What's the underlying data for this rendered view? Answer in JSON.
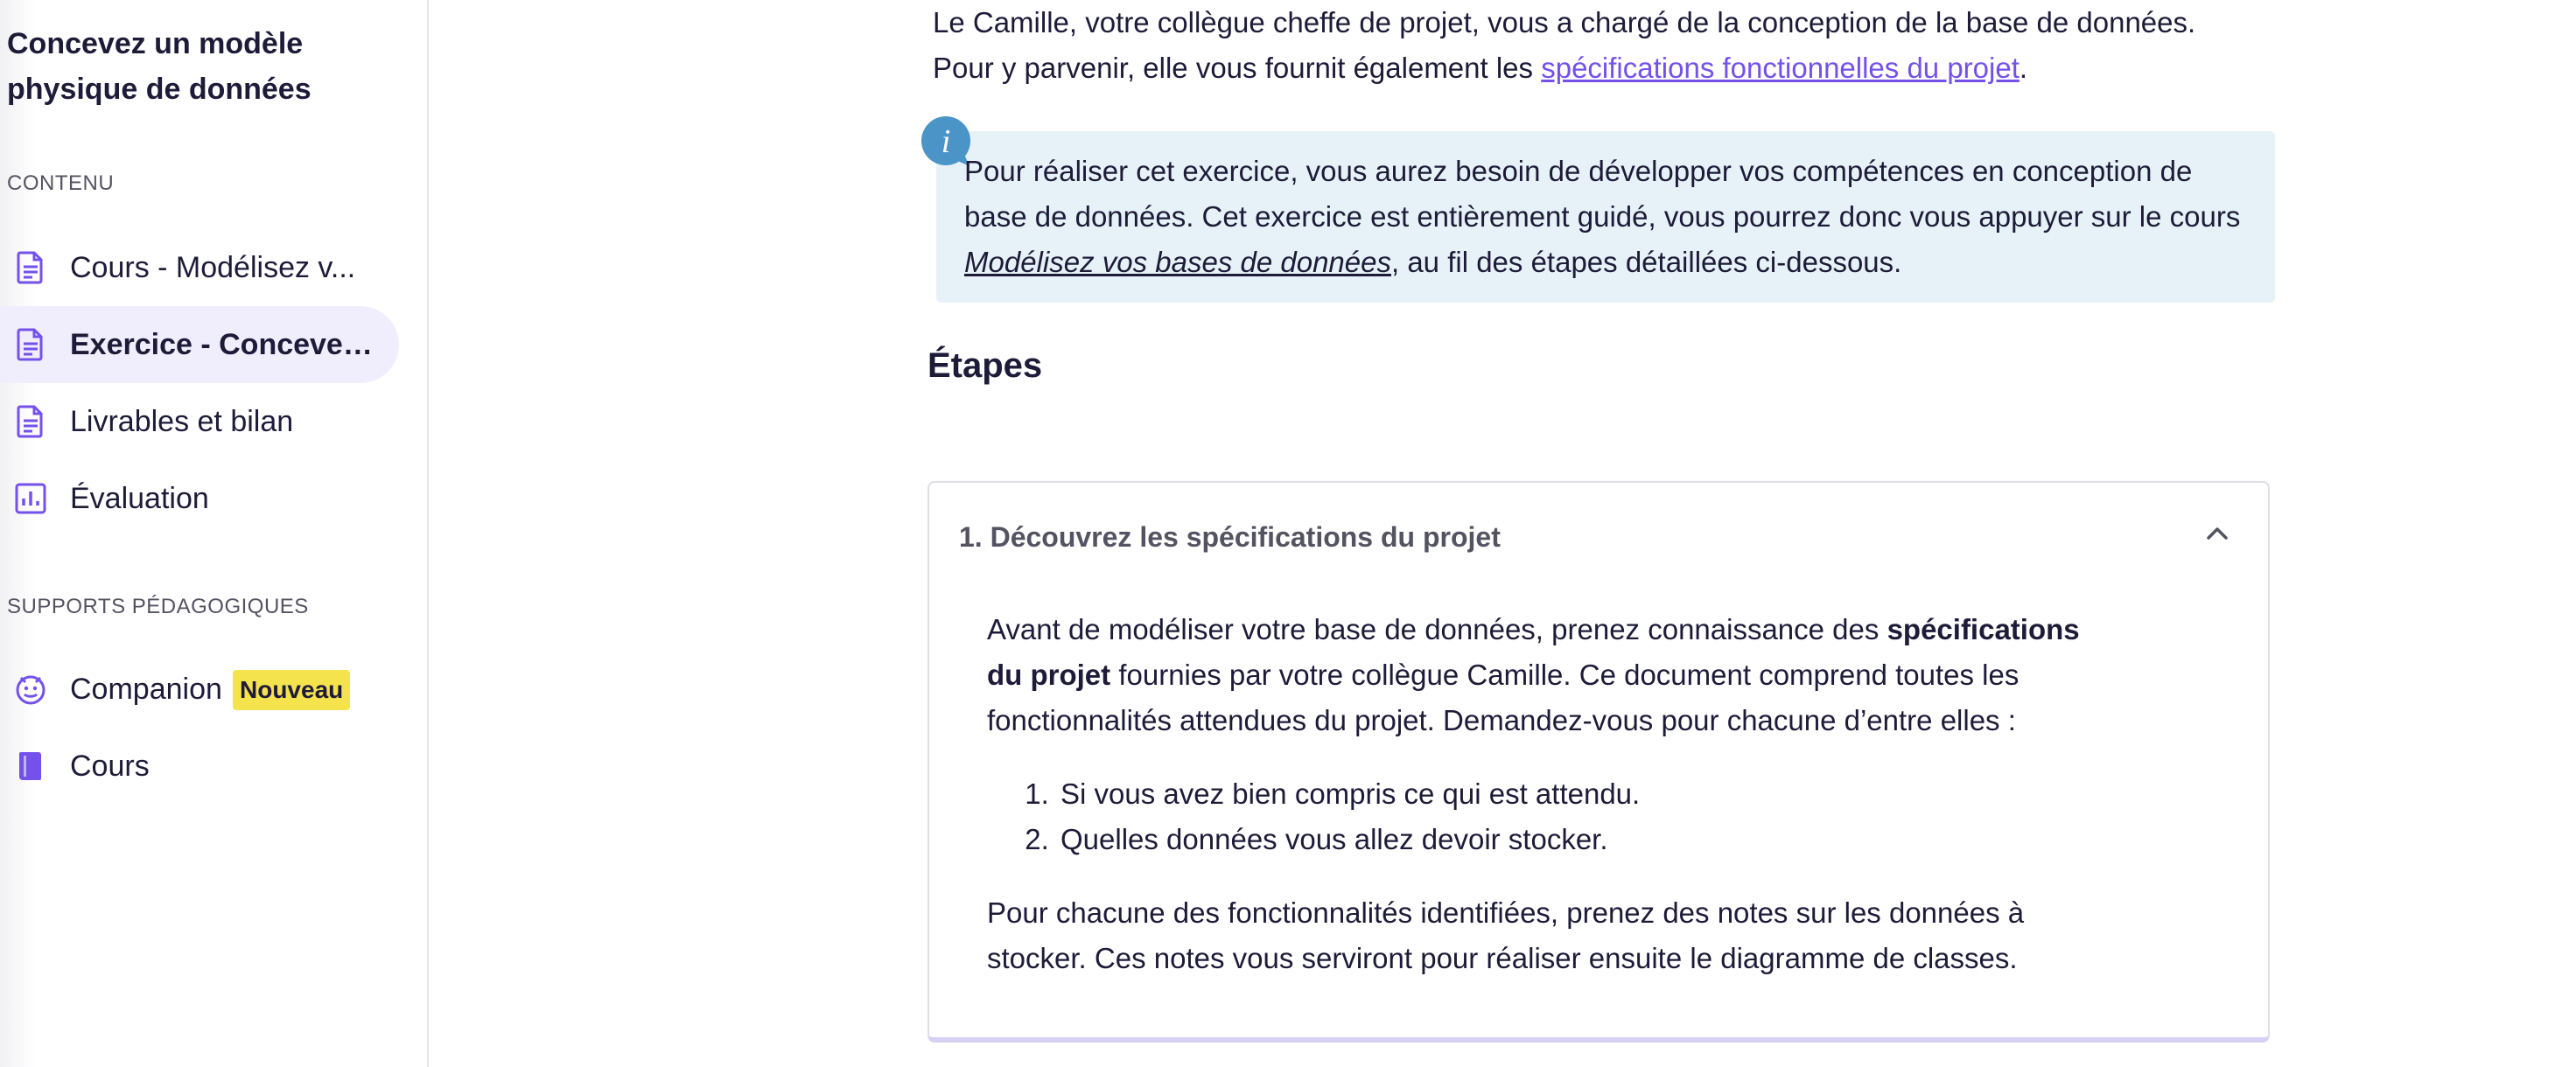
{
  "sidebar": {
    "course_title": "Concevez un modèle physique de données",
    "content_label": "CONTENU",
    "items": [
      {
        "label": "Cours - Modélisez v...",
        "icon": "document-icon"
      },
      {
        "label": "Exercice - Concevez...",
        "icon": "document-icon"
      },
      {
        "label": "Livrables et bilan",
        "icon": "document-icon"
      },
      {
        "label": "Évaluation",
        "icon": "chart-icon"
      }
    ],
    "supports_label": "SUPPORTS PÉDAGOGIQUES",
    "supports": [
      {
        "label": "Companion",
        "badge": "Nouveau",
        "icon": "companion-icon"
      },
      {
        "label": "Cours",
        "icon": "book-icon"
      }
    ]
  },
  "intro": {
    "line1": "Le Camille, votre collègue cheffe de projet, vous a chargé de la conception de la base de données.",
    "line2_before": "Pour y parvenir, elle vous fournit également les ",
    "line2_link": "spécifications fonctionnelles du projet",
    "line2_after": "."
  },
  "info": {
    "before": "Pour réaliser cet exercice, vous aurez besoin de développer vos compétences en conception de base de données. Cet exercice est entièrement guidé, vous pourrez donc vous appuyer sur le cours ",
    "course_link": "Modélisez vos bases de données",
    "after": ", au fil des étapes détaillées ci-dessous."
  },
  "steps_heading": "Étapes",
  "step1": {
    "title": "1. Découvrez les spécifications du projet",
    "p1_before": "Avant de modéliser votre base de données, prenez connaissance des ",
    "p1_bold": "spécifications du projet",
    "p1_after": " fournies par votre collègue Camille. Ce document comprend toutes les fonctionnalités attendues du projet. Demandez-vous pour chacune d’entre elles :",
    "list": [
      "Si vous avez bien compris ce qui est attendu.",
      "Quelles données vous allez devoir stocker."
    ],
    "p2": "Pour chacune des fonctionnalités identifiées, prenez des notes sur les données à stocker. Ces notes vous serviront pour réaliser ensuite le diagramme de classes."
  },
  "colors": {
    "accent": "#7451eb",
    "info_bg": "#e6f2f8",
    "badge_bg": "#f5e34e"
  }
}
